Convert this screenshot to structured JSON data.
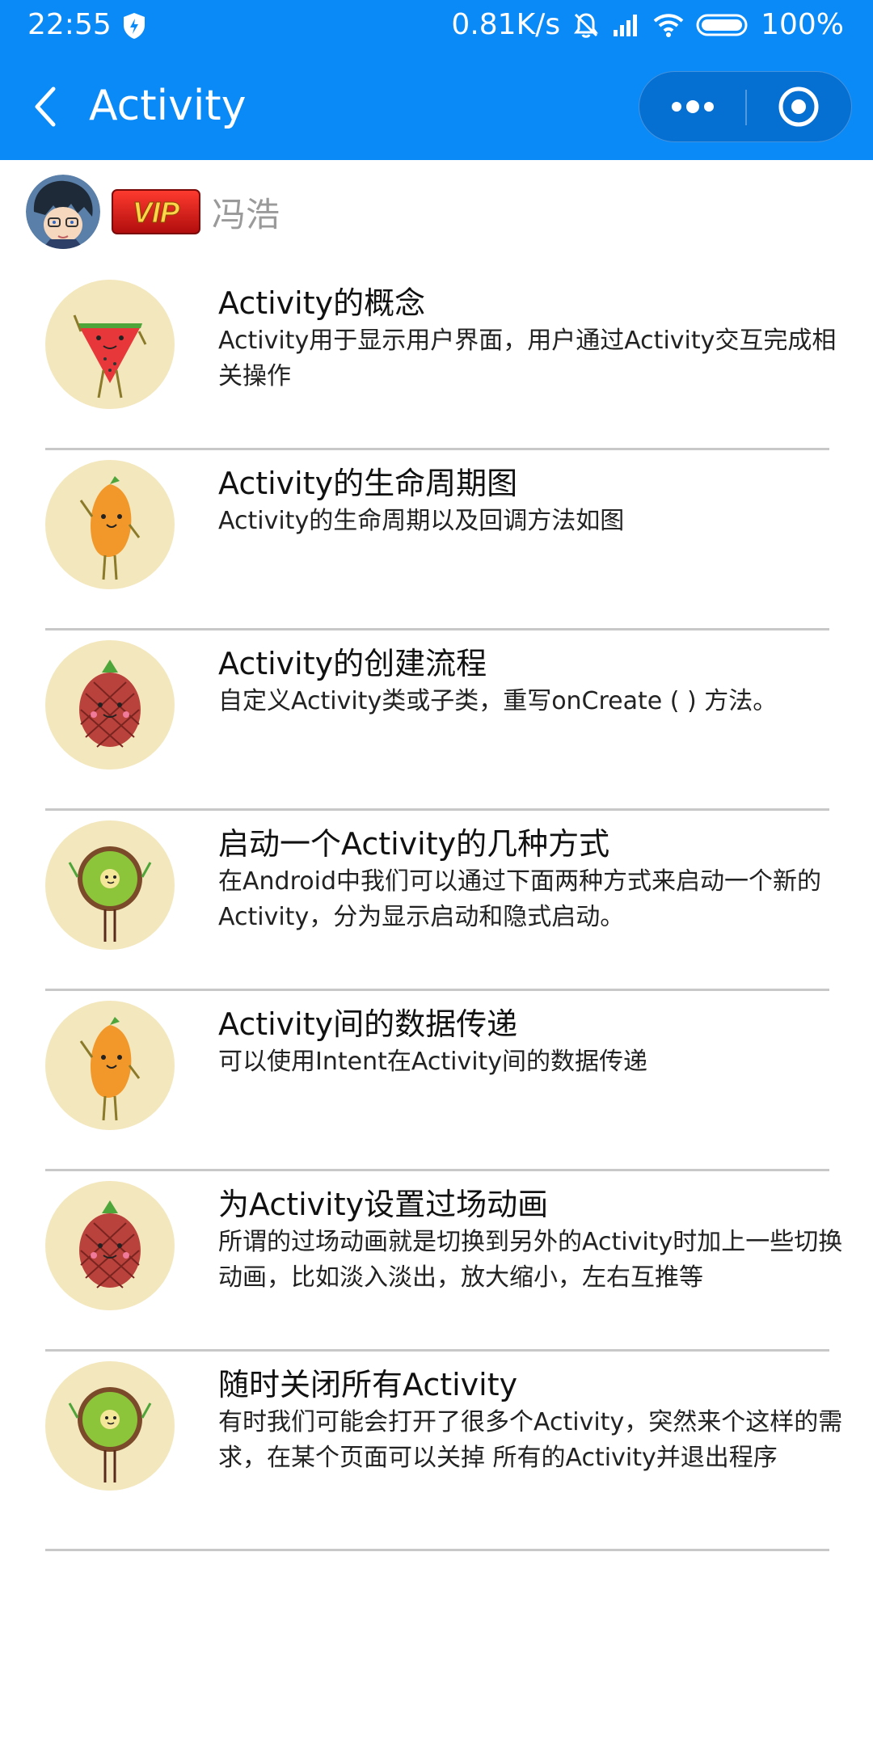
{
  "statusbar": {
    "time": "22:55",
    "speed": "0.81K/s",
    "battery": "100%"
  },
  "navbar": {
    "title": "Activity",
    "more_icon": "ellipsis-icon",
    "close_icon": "target-circle-icon",
    "back_icon": "chevron-left-icon"
  },
  "user": {
    "name": "冯浩",
    "badge": "VIP"
  },
  "colors": {
    "header_bg": "#0a8af7",
    "thumb_bg": "#f3e7bd",
    "divider": "#c8c8c8"
  },
  "items": [
    {
      "title": " Activity的概念",
      "desc": "Activity用于显示用户界面，用户通过Activity交互完成相关操作",
      "icon": "watermelon-character-icon"
    },
    {
      "title": "Activity的生命周期图",
      "desc": "Activity的生命周期以及回调方法如图",
      "icon": "mango-character-icon"
    },
    {
      "title": "Activity的创建流程",
      "desc": "自定义Activity类或子类，重写onCreate ( ) 方法。",
      "icon": "pineapple-character-icon"
    },
    {
      "title": "启动一个Activity的几种方式",
      "desc": "在Android中我们可以通过下面两种方式来启动一个新的Activity，分为显示启动和隐式启动。",
      "icon": "kiwi-character-icon"
    },
    {
      "title": "Activity间的数据传递",
      "desc": "可以使用Intent在Activity间的数据传递",
      "icon": "mango-character-icon"
    },
    {
      "title": "为Activity设置过场动画",
      "desc": "所谓的过场动画就是切换到另外的Activity时加上一些切换动画，比如淡入淡出，放大缩小，左右互推等",
      "icon": "pineapple-character-icon"
    },
    {
      "title": "随时关闭所有Activity",
      "desc": "有时我们可能会打开了很多个Activity，突然来个这样的需求，在某个页面可以关掉 所有的Activity并退出程序",
      "icon": "kiwi-character-icon"
    }
  ]
}
